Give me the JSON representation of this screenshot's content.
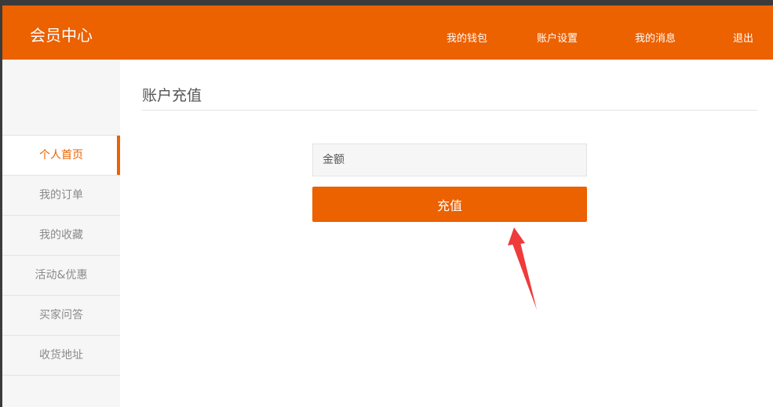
{
  "header": {
    "brand": "会员中心",
    "nav": [
      "我的钱包",
      "账户设置",
      "我的消息",
      "退出"
    ]
  },
  "sidebar": {
    "items": [
      {
        "label": "个人首页",
        "active": true
      },
      {
        "label": "我的订单"
      },
      {
        "label": "我的收藏"
      },
      {
        "label": "活动&优惠"
      },
      {
        "label": "买家问答"
      },
      {
        "label": "收货地址"
      }
    ]
  },
  "main": {
    "title": "账户充值",
    "amount_placeholder": "金额",
    "amount_value": "",
    "recharge_label": "充值"
  },
  "colors": {
    "accent": "#ec6100",
    "annotation_arrow": "#ee3b3b"
  },
  "icons": [
    "annotation-arrow-icon"
  ]
}
